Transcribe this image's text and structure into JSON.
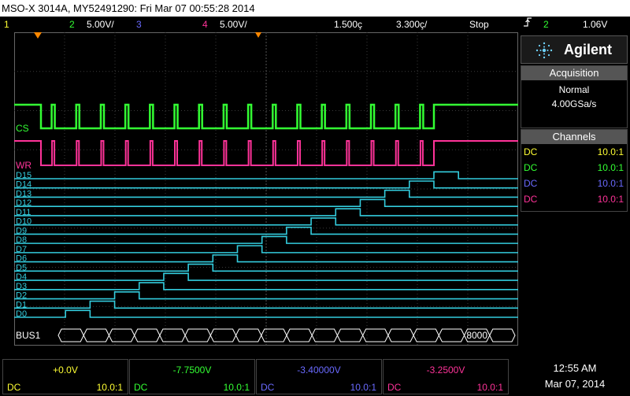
{
  "title": "MSO-X 3014A, MY52491290: Fri Mar 07 00:55:28 2014",
  "status": {
    "ch1": "1",
    "ch2": "2",
    "ch2_scale": "5.00V/",
    "ch3": "3",
    "ch4": "4",
    "ch4_scale": "5.00V/",
    "timebase_pos": "1.500ç",
    "timebase_scale": "3.300ç/",
    "run_state": "Stop",
    "trigger_icon": "trigger-edge-icon",
    "trigger_ch": "2",
    "trigger_level": "1.06V"
  },
  "logo": {
    "brand": "Agilent",
    "icon": "agilent-spark-icon"
  },
  "acquisition": {
    "head": "Acquisition",
    "mode": "Normal",
    "rate": "4.00GSa/s"
  },
  "channels": {
    "head": "Channels",
    "rows": [
      {
        "coupling": "DC",
        "ratio": "10.0:1",
        "color": "#ffff33"
      },
      {
        "coupling": "DC",
        "ratio": "10.0:1",
        "color": "#33ff33"
      },
      {
        "coupling": "DC",
        "ratio": "10.0:1",
        "color": "#6a6aff"
      },
      {
        "coupling": "DC",
        "ratio": "10.0:1",
        "color": "#ff3399"
      }
    ]
  },
  "bottom": [
    {
      "value": "+0.0V",
      "coupling": "DC",
      "ratio": "10.0:1",
      "color": "#ffff33"
    },
    {
      "value": "-7.7500V",
      "coupling": "DC",
      "ratio": "10.0:1",
      "color": "#33ff33"
    },
    {
      "value": "-3.40000V",
      "coupling": "DC",
      "ratio": "10.0:1",
      "color": "#6a6aff"
    },
    {
      "value": "-3.2500V",
      "coupling": "DC",
      "ratio": "10.0:1",
      "color": "#ff3399"
    }
  ],
  "clock": {
    "time": "12:55 AM",
    "date": "Mar 07, 2014"
  },
  "waveform": {
    "cs_label": "CS",
    "wr_label": "WR",
    "bus_label": "BUS1",
    "bus_value": "8000",
    "digital_labels": [
      "D0",
      "D1",
      "D2",
      "D3",
      "D4",
      "D5",
      "D6",
      "D7",
      "D8",
      "D9",
      "D10",
      "D11",
      "D12",
      "D13",
      "D14",
      "D15"
    ]
  },
  "colors": {
    "ch1": "#ffff33",
    "ch2": "#33ff33",
    "ch3": "#6a6aff",
    "ch4": "#ff3399",
    "digital": "#33ccdd",
    "grid": "#444"
  }
}
